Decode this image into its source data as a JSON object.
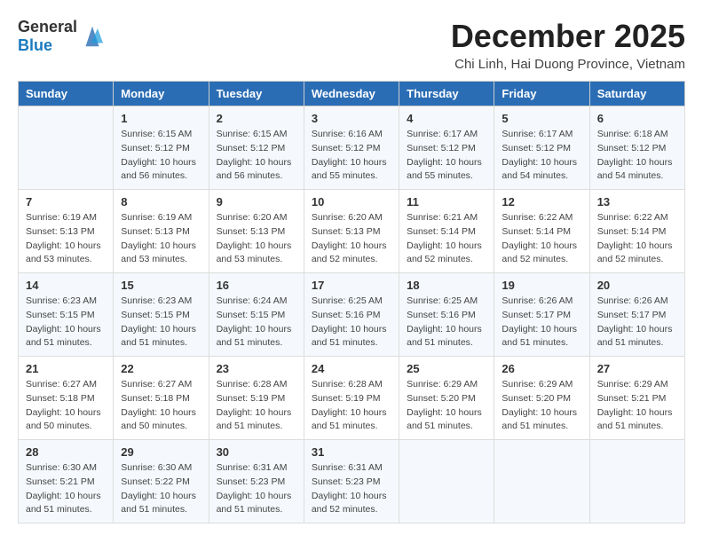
{
  "logo": {
    "text_general": "General",
    "text_blue": "Blue"
  },
  "title": "December 2025",
  "subtitle": "Chi Linh, Hai Duong Province, Vietnam",
  "days_of_week": [
    "Sunday",
    "Monday",
    "Tuesday",
    "Wednesday",
    "Thursday",
    "Friday",
    "Saturday"
  ],
  "weeks": [
    [
      {
        "day": "",
        "info": ""
      },
      {
        "day": "1",
        "info": "Sunrise: 6:15 AM\nSunset: 5:12 PM\nDaylight: 10 hours\nand 56 minutes."
      },
      {
        "day": "2",
        "info": "Sunrise: 6:15 AM\nSunset: 5:12 PM\nDaylight: 10 hours\nand 56 minutes."
      },
      {
        "day": "3",
        "info": "Sunrise: 6:16 AM\nSunset: 5:12 PM\nDaylight: 10 hours\nand 55 minutes."
      },
      {
        "day": "4",
        "info": "Sunrise: 6:17 AM\nSunset: 5:12 PM\nDaylight: 10 hours\nand 55 minutes."
      },
      {
        "day": "5",
        "info": "Sunrise: 6:17 AM\nSunset: 5:12 PM\nDaylight: 10 hours\nand 54 minutes."
      },
      {
        "day": "6",
        "info": "Sunrise: 6:18 AM\nSunset: 5:12 PM\nDaylight: 10 hours\nand 54 minutes."
      }
    ],
    [
      {
        "day": "7",
        "info": "Sunrise: 6:19 AM\nSunset: 5:13 PM\nDaylight: 10 hours\nand 53 minutes."
      },
      {
        "day": "8",
        "info": "Sunrise: 6:19 AM\nSunset: 5:13 PM\nDaylight: 10 hours\nand 53 minutes."
      },
      {
        "day": "9",
        "info": "Sunrise: 6:20 AM\nSunset: 5:13 PM\nDaylight: 10 hours\nand 53 minutes."
      },
      {
        "day": "10",
        "info": "Sunrise: 6:20 AM\nSunset: 5:13 PM\nDaylight: 10 hours\nand 52 minutes."
      },
      {
        "day": "11",
        "info": "Sunrise: 6:21 AM\nSunset: 5:14 PM\nDaylight: 10 hours\nand 52 minutes."
      },
      {
        "day": "12",
        "info": "Sunrise: 6:22 AM\nSunset: 5:14 PM\nDaylight: 10 hours\nand 52 minutes."
      },
      {
        "day": "13",
        "info": "Sunrise: 6:22 AM\nSunset: 5:14 PM\nDaylight: 10 hours\nand 52 minutes."
      }
    ],
    [
      {
        "day": "14",
        "info": "Sunrise: 6:23 AM\nSunset: 5:15 PM\nDaylight: 10 hours\nand 51 minutes."
      },
      {
        "day": "15",
        "info": "Sunrise: 6:23 AM\nSunset: 5:15 PM\nDaylight: 10 hours\nand 51 minutes."
      },
      {
        "day": "16",
        "info": "Sunrise: 6:24 AM\nSunset: 5:15 PM\nDaylight: 10 hours\nand 51 minutes."
      },
      {
        "day": "17",
        "info": "Sunrise: 6:25 AM\nSunset: 5:16 PM\nDaylight: 10 hours\nand 51 minutes."
      },
      {
        "day": "18",
        "info": "Sunrise: 6:25 AM\nSunset: 5:16 PM\nDaylight: 10 hours\nand 51 minutes."
      },
      {
        "day": "19",
        "info": "Sunrise: 6:26 AM\nSunset: 5:17 PM\nDaylight: 10 hours\nand 51 minutes."
      },
      {
        "day": "20",
        "info": "Sunrise: 6:26 AM\nSunset: 5:17 PM\nDaylight: 10 hours\nand 51 minutes."
      }
    ],
    [
      {
        "day": "21",
        "info": "Sunrise: 6:27 AM\nSunset: 5:18 PM\nDaylight: 10 hours\nand 50 minutes."
      },
      {
        "day": "22",
        "info": "Sunrise: 6:27 AM\nSunset: 5:18 PM\nDaylight: 10 hours\nand 50 minutes."
      },
      {
        "day": "23",
        "info": "Sunrise: 6:28 AM\nSunset: 5:19 PM\nDaylight: 10 hours\nand 51 minutes."
      },
      {
        "day": "24",
        "info": "Sunrise: 6:28 AM\nSunset: 5:19 PM\nDaylight: 10 hours\nand 51 minutes."
      },
      {
        "day": "25",
        "info": "Sunrise: 6:29 AM\nSunset: 5:20 PM\nDaylight: 10 hours\nand 51 minutes."
      },
      {
        "day": "26",
        "info": "Sunrise: 6:29 AM\nSunset: 5:20 PM\nDaylight: 10 hours\nand 51 minutes."
      },
      {
        "day": "27",
        "info": "Sunrise: 6:29 AM\nSunset: 5:21 PM\nDaylight: 10 hours\nand 51 minutes."
      }
    ],
    [
      {
        "day": "28",
        "info": "Sunrise: 6:30 AM\nSunset: 5:21 PM\nDaylight: 10 hours\nand 51 minutes."
      },
      {
        "day": "29",
        "info": "Sunrise: 6:30 AM\nSunset: 5:22 PM\nDaylight: 10 hours\nand 51 minutes."
      },
      {
        "day": "30",
        "info": "Sunrise: 6:31 AM\nSunset: 5:23 PM\nDaylight: 10 hours\nand 51 minutes."
      },
      {
        "day": "31",
        "info": "Sunrise: 6:31 AM\nSunset: 5:23 PM\nDaylight: 10 hours\nand 52 minutes."
      },
      {
        "day": "",
        "info": ""
      },
      {
        "day": "",
        "info": ""
      },
      {
        "day": "",
        "info": ""
      }
    ]
  ]
}
